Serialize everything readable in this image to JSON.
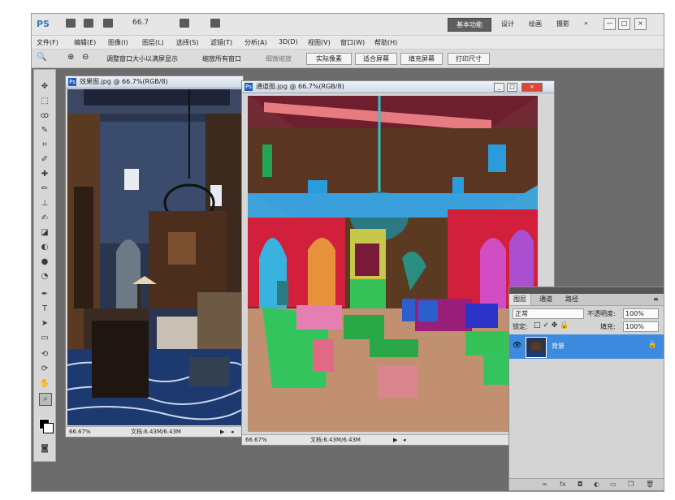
{
  "app": {
    "logo": "PS",
    "zoom_value": "66.7",
    "workspace_button": "基本功能",
    "workspace_links": [
      "设计",
      "绘画",
      "摄影",
      "»"
    ],
    "window_controls": [
      "—",
      "□",
      "×"
    ]
  },
  "menu": {
    "items": [
      "文件(F)",
      "编辑(E)",
      "图像(I)",
      "图层(L)",
      "选择(S)",
      "滤镜(T)",
      "分析(A)",
      "3D(D)",
      "视图(V)",
      "窗口(W)",
      "帮助(H)"
    ]
  },
  "options": {
    "resize_windows": "调整窗口大小以满屏显示",
    "zoom_all": "缩放所有窗口",
    "scrubby": "细微缩放",
    "actual_pixels": "实际像素",
    "fit_screen": "适合屏幕",
    "fill_screen": "填充屏幕",
    "print_size": "打印尺寸"
  },
  "doc1": {
    "title": "效果图.jpg @ 66.7%(RGB/8)",
    "zoom": "66.67%",
    "status": "文档:6.43M/6.43M"
  },
  "doc2": {
    "title": "通道图.jpg @ 66.7%(RGB/8)",
    "zoom": "66.67%",
    "status": "文档:6.43M/6.43M"
  },
  "layers": {
    "tabs": [
      "图层",
      "通道",
      "路径"
    ],
    "blend_mode": "正常",
    "opacity_label": "不透明度:",
    "opacity_value": "100%",
    "lock_label": "锁定:",
    "fill_label": "填充:",
    "fill_value": "100%",
    "layer_name": "背景"
  },
  "colors": {
    "accent": "#3d8bde",
    "workspace_bg": "#6c6c6c"
  }
}
